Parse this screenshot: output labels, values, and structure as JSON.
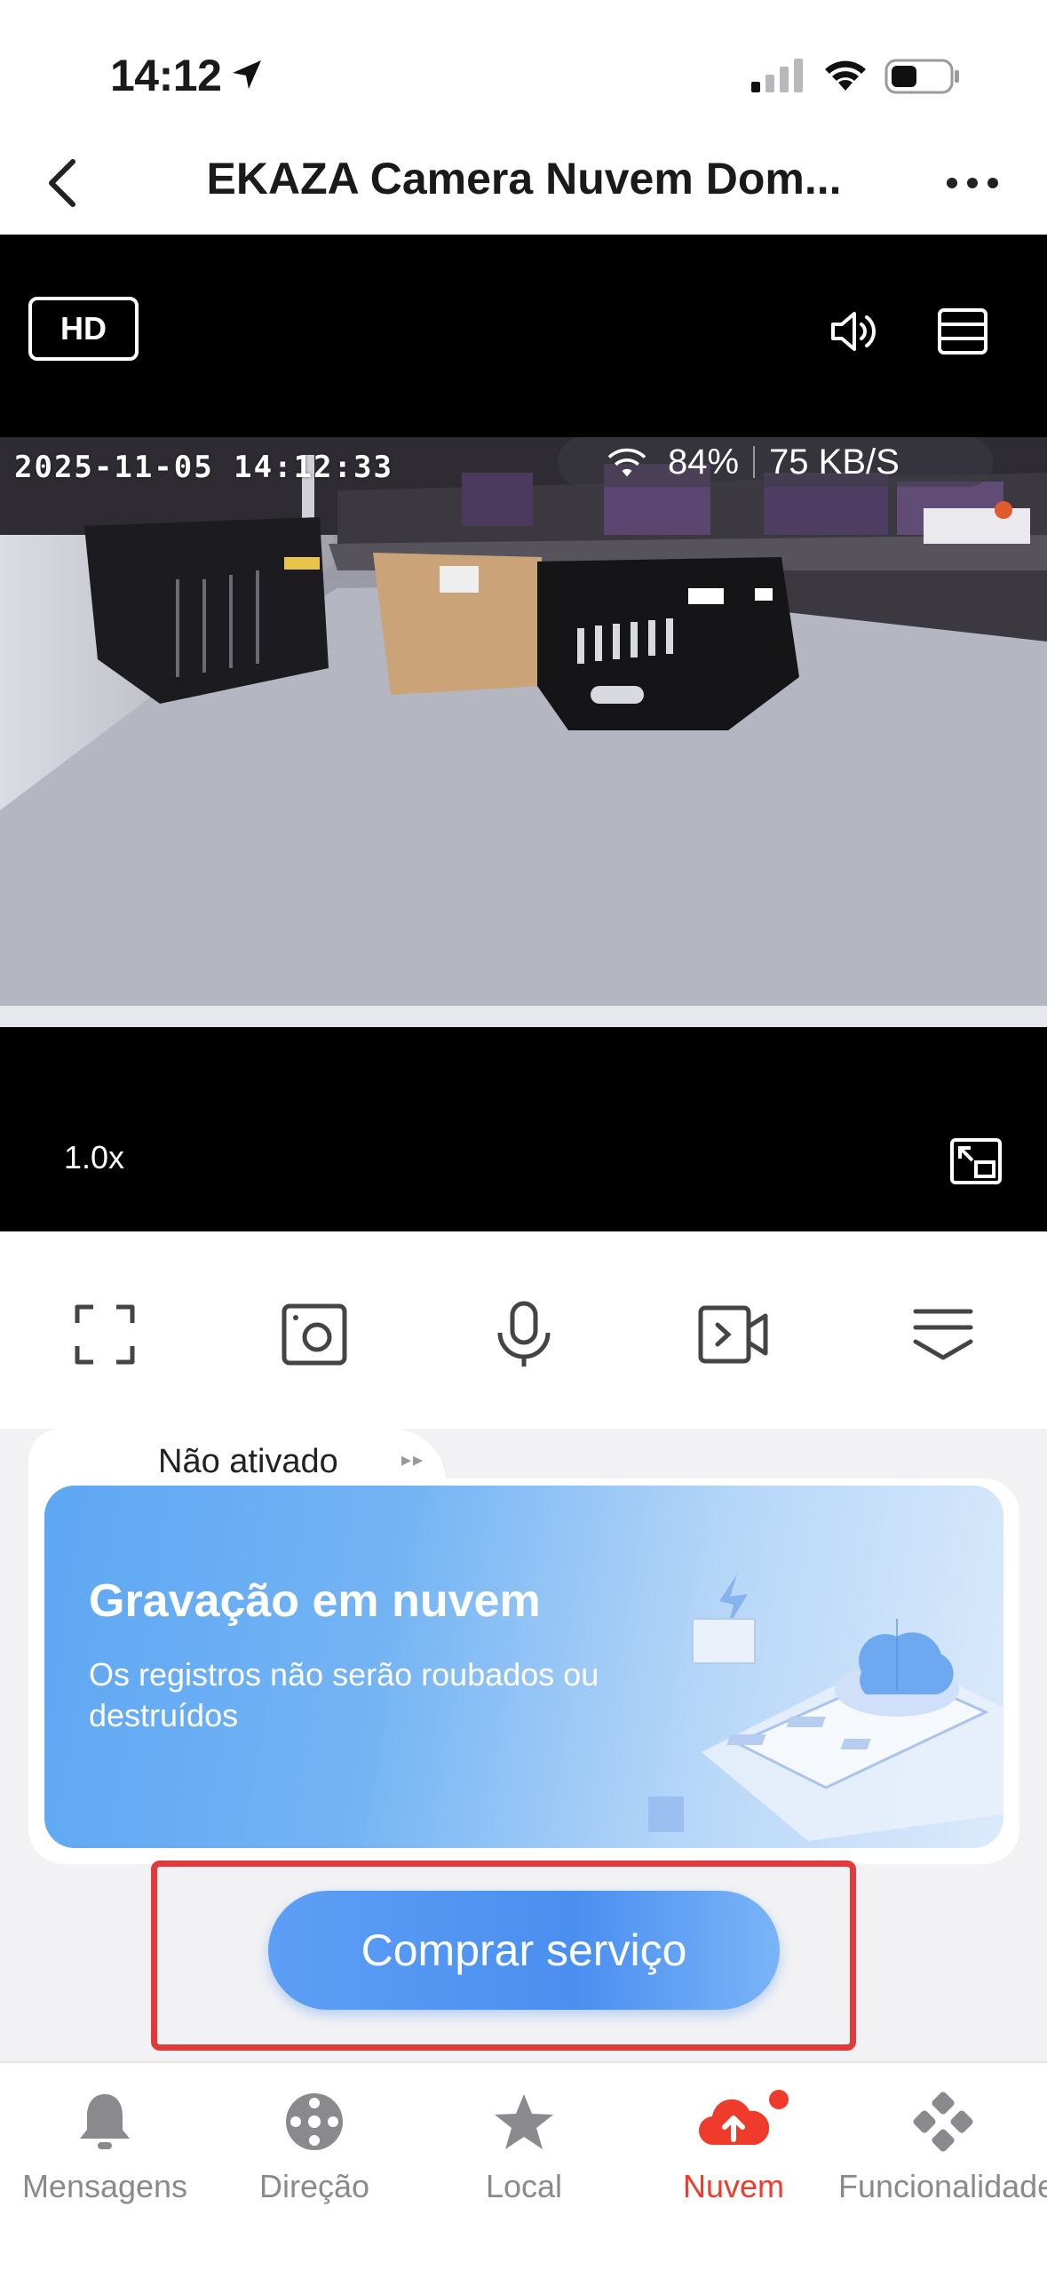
{
  "status_bar": {
    "time": "14:12"
  },
  "nav": {
    "title": "EKAZA Camera Nuvem Dom..."
  },
  "video": {
    "quality_badge": "HD",
    "timestamp": "2025-11-05 14:12:33",
    "signal_percent": "84%",
    "bitrate": "75 KB/S",
    "zoom": "1.0x"
  },
  "cloud": {
    "status_tab": "Não ativado",
    "banner_title": "Gravação em nuvem",
    "banner_subtitle": "Os registros não serão roubados ou destruídos",
    "buy_button": "Comprar serviço"
  },
  "tabbar": {
    "items": [
      {
        "label": "Mensagens",
        "icon": "bell-icon"
      },
      {
        "label": "Direção",
        "icon": "joystick-icon"
      },
      {
        "label": "Local",
        "icon": "star-icon"
      },
      {
        "label": "Nuvem",
        "icon": "cloud-upload-icon"
      },
      {
        "label": "Funcionalidade",
        "icon": "features-icon"
      }
    ]
  },
  "colors": {
    "accent": "#ee3b2b",
    "button_blue": "#4a8ff0",
    "highlight_frame": "#e23a3a"
  }
}
